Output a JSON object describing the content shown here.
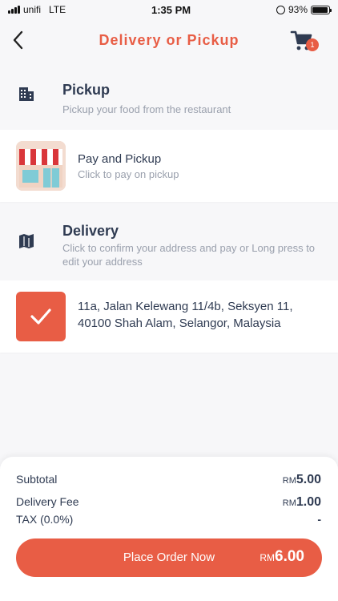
{
  "status_bar": {
    "carrier": "unifi",
    "network": "LTE",
    "time": "1:35 PM",
    "battery_percent": "93%",
    "battery_level": 0.93
  },
  "header": {
    "title": "Delivery or Pickup",
    "cart_count": "1",
    "back_icon": "chevron-left-icon",
    "cart_icon": "shopping-cart-icon"
  },
  "pickup": {
    "title": "Pickup",
    "subtitle": "Pickup your food from the restaurant",
    "icon": "building-icon",
    "option": {
      "title": "Pay and Pickup",
      "subtitle": "Click to pay on pickup",
      "icon": "storefront-icon"
    }
  },
  "delivery": {
    "title": "Delivery",
    "subtitle": "Click to confirm your address and pay or Long press to edit your address",
    "icon": "map-icon",
    "address": {
      "text": "11a, Jalan Kelewang 11/4b, Seksyen 11, 40100 Shah Alam, Selangor, Malaysia",
      "selected": true,
      "icon": "checkmark-icon"
    }
  },
  "summary": {
    "subtotal_label": "Subtotal",
    "subtotal_currency": "RM",
    "subtotal_value": "5.00",
    "delivery_fee_label": "Delivery Fee",
    "delivery_fee_currency": "RM",
    "delivery_fee_value": "1.00",
    "tax_label": "TAX (0.0%)",
    "tax_value": "-"
  },
  "order_button": {
    "label": "Place Order Now",
    "currency": "RM",
    "total": "6.00"
  },
  "colors": {
    "accent": "#e85d45",
    "text": "#2f3b52",
    "muted": "#9aa0ad",
    "background": "#f7f7f9"
  }
}
